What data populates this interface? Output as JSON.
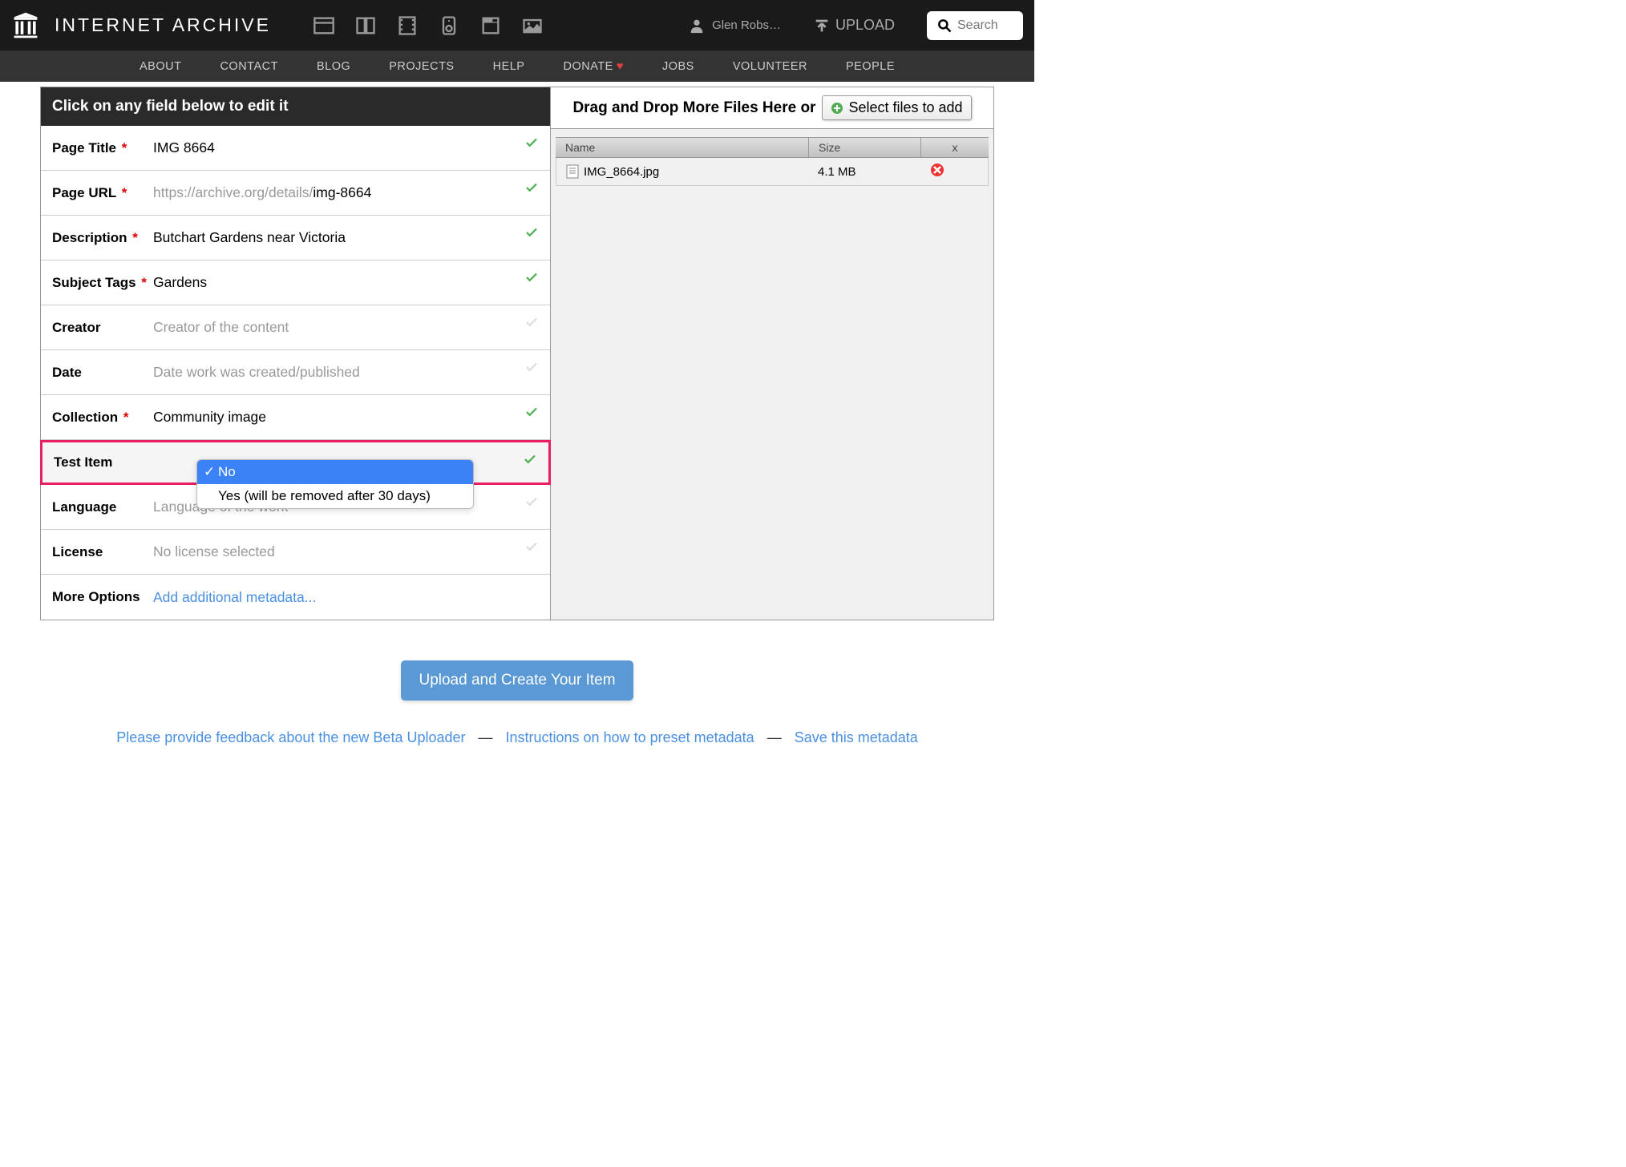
{
  "brand": "INTERNET ARCHIVE",
  "user_name": "Glen Robs…",
  "upload_label": "UPLOAD",
  "search_placeholder": "Search",
  "subnav": [
    "ABOUT",
    "CONTACT",
    "BLOG",
    "PROJECTS",
    "HELP",
    "DONATE",
    "JOBS",
    "VOLUNTEER",
    "PEOPLE"
  ],
  "left": {
    "header": "Click on any field below to edit it",
    "fields": {
      "page_title": {
        "label": "Page Title",
        "required": true,
        "value": "IMG 8664",
        "valid": true
      },
      "page_url": {
        "label": "Page URL",
        "required": true,
        "prefix": "https://archive.org/details/",
        "slug": "img-8664",
        "valid": true
      },
      "description": {
        "label": "Description",
        "required": true,
        "value": "Butchart Gardens near Victoria",
        "valid": true
      },
      "subject_tags": {
        "label": "Subject Tags",
        "required": true,
        "value": "Gardens",
        "valid": true
      },
      "creator": {
        "label": "Creator",
        "required": false,
        "placeholder": "Creator of the content",
        "valid": false
      },
      "date": {
        "label": "Date",
        "required": false,
        "placeholder": "Date work was created/published",
        "valid": false
      },
      "collection": {
        "label": "Collection",
        "required": true,
        "value": "Community image",
        "valid": true
      },
      "test_item": {
        "label": "Test Item",
        "options": [
          "No",
          "Yes (will be removed after 30 days)"
        ],
        "selected": "No",
        "valid": true
      },
      "language": {
        "label": "Language",
        "required": false,
        "placeholder": "Language of the work",
        "valid": false
      },
      "license": {
        "label": "License",
        "required": false,
        "placeholder": "No license selected",
        "valid": false
      },
      "more_options": {
        "label": "More Options",
        "link": "Add additional metadata..."
      }
    }
  },
  "right": {
    "drop_text": "Drag and Drop More Files Here or",
    "select_button": "Select files to add",
    "columns": {
      "name": "Name",
      "size": "Size",
      "x": "x"
    },
    "files": [
      {
        "name": "IMG_8664.jpg",
        "size": "4.1 MB"
      }
    ]
  },
  "submit": "Upload and Create Your Item",
  "footer": {
    "feedback": "Please provide feedback about the new Beta Uploader",
    "instructions": "Instructions on how to preset metadata",
    "save": "Save this metadata"
  }
}
